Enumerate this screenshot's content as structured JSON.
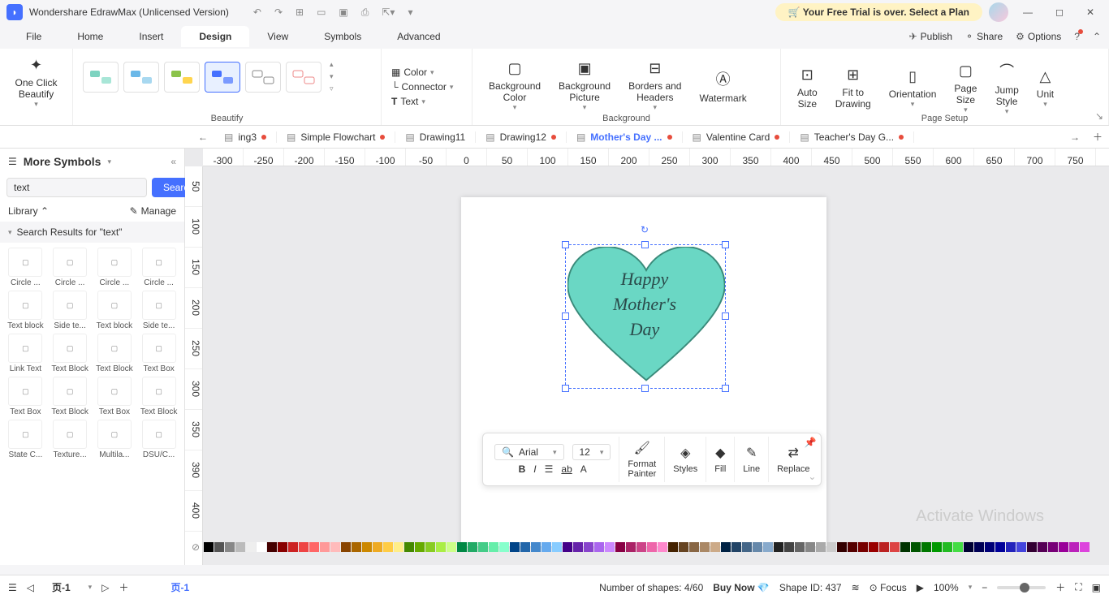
{
  "app": {
    "title": "Wondershare EdrawMax (Unlicensed Version)",
    "trial_banner": "Your Free Trial is over. Select a Plan"
  },
  "menu": {
    "items": [
      "File",
      "Home",
      "Insert",
      "Design",
      "View",
      "Symbols",
      "Advanced"
    ],
    "active": "Design",
    "right": {
      "publish": "Publish",
      "share": "Share",
      "options": "Options"
    }
  },
  "ribbon": {
    "beautify_btn": "One Click\nBeautify",
    "beautify_label": "Beautify",
    "color": "Color",
    "connector": "Connector",
    "text": "Text",
    "bg_color": "Background\nColor",
    "bg_pic": "Background\nPicture",
    "borders": "Borders and\nHeaders",
    "watermark": "Watermark",
    "bg_label": "Background",
    "auto_size": "Auto\nSize",
    "fit": "Fit to\nDrawing",
    "orientation": "Orientation",
    "page_size": "Page\nSize",
    "jump_style": "Jump\nStyle",
    "unit": "Unit",
    "setup_label": "Page Setup"
  },
  "tabs": [
    {
      "label": "ing3",
      "modified": true
    },
    {
      "label": "Simple Flowchart",
      "modified": true
    },
    {
      "label": "Drawing11",
      "modified": false
    },
    {
      "label": "Drawing12",
      "modified": true
    },
    {
      "label": "Mother's Day ...",
      "modified": true,
      "active": true
    },
    {
      "label": "Valentine Card",
      "modified": true
    },
    {
      "label": "Teacher's Day G...",
      "modified": true
    }
  ],
  "sidebar": {
    "title": "More Symbols",
    "search_value": "text",
    "search_btn": "Search",
    "library": "Library",
    "manage": "Manage",
    "section_title": "Search Results for  \"text\"",
    "symbols": [
      "Circle ...",
      "Circle ...",
      "Circle ...",
      "Circle ...",
      "Text block",
      "Side te...",
      "Text block",
      "Side te...",
      "Link Text",
      "Text Block",
      "Text Block",
      "Text Box",
      "Text Box",
      "Text Block",
      "Text Box",
      "Text Block",
      "State C...",
      "Texture...",
      "Multila...",
      "DSU/C..."
    ]
  },
  "ruler_h": [
    "-300",
    "-250",
    "-200",
    "-150",
    "-100",
    "-50",
    "0",
    "50",
    "100",
    "150",
    "200",
    "250",
    "300",
    "350",
    "400",
    "450",
    "500",
    "550",
    "600",
    "650",
    "700",
    "750"
  ],
  "ruler_v": [
    "50",
    "100",
    "150",
    "200",
    "250",
    "300",
    "350",
    "390",
    "400"
  ],
  "heart_text": "Happy\nMother's\nDay",
  "float_toolbar": {
    "font": "Arial",
    "size": "12",
    "format_painter": "Format\nPainter",
    "styles": "Styles",
    "fill": "Fill",
    "line": "Line",
    "replace": "Replace"
  },
  "colorbar": [
    "#000",
    "#555",
    "#888",
    "#bbb",
    "#eee",
    "#fff",
    "#400",
    "#800",
    "#c22",
    "#e44",
    "#f66",
    "#f99",
    "#fbb",
    "#840",
    "#a60",
    "#c80",
    "#ea2",
    "#fc4",
    "#fe8",
    "#480",
    "#6a0",
    "#8c2",
    "#ae4",
    "#cf8",
    "#084",
    "#2a6",
    "#4c8",
    "#6ea",
    "#8fc",
    "#048",
    "#26a",
    "#48c",
    "#6ae",
    "#8cf",
    "#408",
    "#62a",
    "#84c",
    "#a6e",
    "#c8f",
    "#804",
    "#a26",
    "#c48",
    "#e6a",
    "#f8c",
    "#420",
    "#642",
    "#864",
    "#a86",
    "#ca8",
    "#024",
    "#246",
    "#468",
    "#68a",
    "#8ac",
    "#222",
    "#444",
    "#666",
    "#888",
    "#aaa",
    "#ccc",
    "#300",
    "#500",
    "#700",
    "#900",
    "#b22",
    "#d44",
    "#030",
    "#050",
    "#070",
    "#090",
    "#2b2",
    "#4d4",
    "#003",
    "#005",
    "#007",
    "#009",
    "#22b",
    "#44d",
    "#303",
    "#505",
    "#707",
    "#909",
    "#b2b",
    "#d4d"
  ],
  "status": {
    "page_tab": "页-1",
    "page_tab2": "页-1",
    "shapes": "Number of shapes: 4/60",
    "buy": "Buy Now",
    "shape_id": "Shape ID: 437",
    "focus": "Focus",
    "zoom": "100%"
  },
  "watermark": {
    "line1": "Activate Windows"
  }
}
